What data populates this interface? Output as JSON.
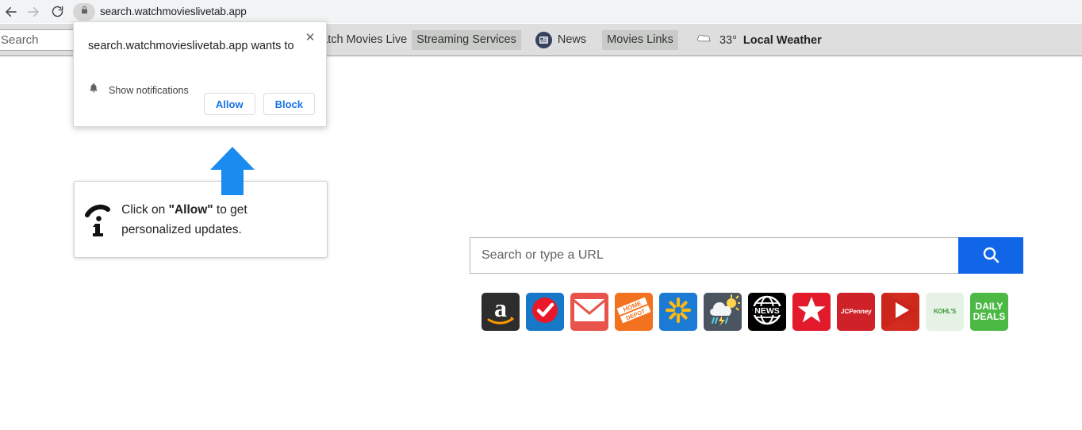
{
  "browser": {
    "back_icon": "back-arrow-icon",
    "forward_icon": "forward-arrow-icon",
    "reload_icon": "reload-icon",
    "site_lock_icon": "lock-icon",
    "url": "search.watchmovieslivetab.app"
  },
  "ext_toolbar": {
    "search_placeholder": "Search",
    "search_value": "",
    "links": [
      {
        "label": "Watch Movies Live",
        "highlighted": false
      },
      {
        "label": "Streaming Services",
        "highlighted": true
      },
      {
        "label": "News",
        "highlighted": false,
        "icon": "newspaper-icon"
      },
      {
        "label": "Movies Links",
        "highlighted": true
      }
    ],
    "weather": {
      "icon": "cloud-icon",
      "temperature": "33°",
      "label": "Local Weather"
    }
  },
  "permission_popup": {
    "title": "search.watchmovieslivetab.app wants to",
    "close_icon": "close-icon",
    "option_icon": "bell-icon",
    "option_label": "Show notifications",
    "allow_label": "Allow",
    "block_label": "Block"
  },
  "callout": {
    "arrow_icon": "up-arrow-icon",
    "arrow_color": "#1a8cf0",
    "info_icon": "cursor-info-icon",
    "text_before": "Click on ",
    "text_emphasis": "\"Allow\"",
    "text_after": " to get personalized updates."
  },
  "newtab": {
    "search_placeholder": "Search or type a URL",
    "search_value": "",
    "search_button_icon": "search-icon",
    "search_button_color": "#1166e8",
    "tiles": [
      {
        "name": "amazon",
        "label": "a",
        "bg": "#2d2d2d",
        "fg": "#ffffff"
      },
      {
        "name": "checkmark",
        "label": "",
        "bg": "#1878c8",
        "fg": "#e8182a"
      },
      {
        "name": "gmail",
        "label": "",
        "bg": "#e8544b",
        "fg": "#ffffff"
      },
      {
        "name": "home-depot",
        "label": "HOME DEPOT",
        "bg": "#f3721f",
        "fg": "#ffffff"
      },
      {
        "name": "walmart",
        "label": "",
        "bg": "#1a7ad4",
        "fg": "#fdb913"
      },
      {
        "name": "weather",
        "label": "",
        "bg": "#4a5560",
        "fg": "#ffffff"
      },
      {
        "name": "news",
        "label": "NEWS",
        "bg": "#000000",
        "fg": "#ffffff"
      },
      {
        "name": "macys",
        "label": "",
        "bg": "#e21a2c",
        "fg": "#ffffff"
      },
      {
        "name": "jcpenney",
        "label": "JCPenney",
        "bg": "#cf2128",
        "fg": "#ffffff"
      },
      {
        "name": "youtube",
        "label": "",
        "bg": "#d42b20",
        "fg": "#ffffff"
      },
      {
        "name": "kohls",
        "label": "KOHL'S",
        "bg": "#e6f2e6",
        "fg": "#3d9b35"
      },
      {
        "name": "daily-deals",
        "label": "DAILY DEALS",
        "bg": "#4cb944",
        "fg": "#ffffff"
      }
    ]
  }
}
